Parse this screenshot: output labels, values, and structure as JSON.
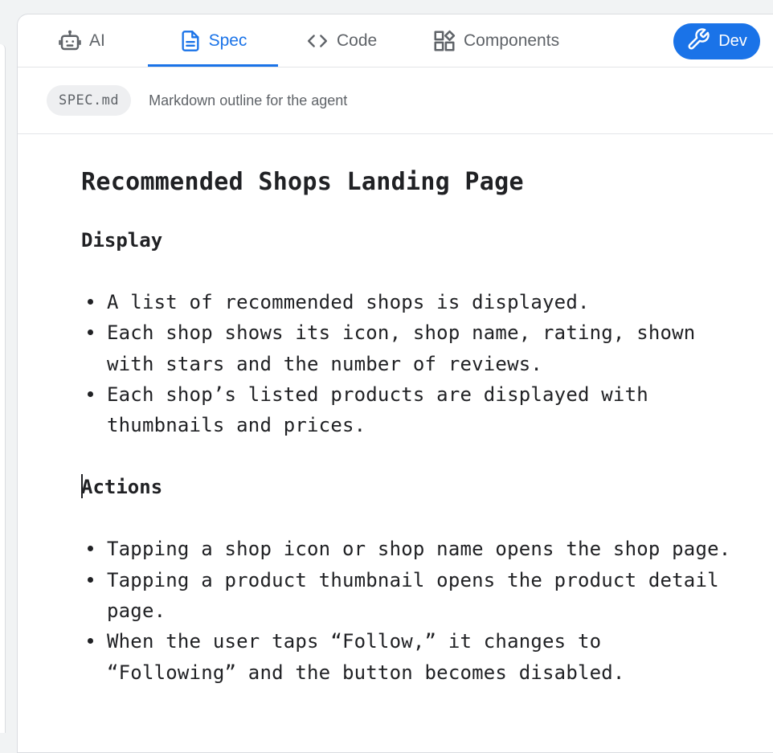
{
  "tabs": [
    {
      "label": "AI",
      "icon": "robot-icon",
      "active": false
    },
    {
      "label": "Spec",
      "icon": "document-icon",
      "active": true
    },
    {
      "label": "Code",
      "icon": "code-brackets-icon",
      "active": false
    },
    {
      "label": "Components",
      "icon": "components-grid-icon",
      "active": false
    }
  ],
  "dev_button": {
    "label": "Dev",
    "icon": "wrench-icon"
  },
  "file": {
    "name": "SPEC.md",
    "description": "Markdown outline for the agent"
  },
  "document": {
    "title": "Recommended Shops Landing Page",
    "sections": [
      {
        "heading": "Display",
        "items": [
          "A list of recommended shops is displayed.",
          "Each shop shows its icon, shop name, rating, shown with stars and the number of reviews.",
          "Each shop’s listed products are displayed with thumbnails and prices."
        ]
      },
      {
        "heading": "Actions",
        "items": [
          "Tapping a shop icon or shop name opens the shop page.",
          "Tapping a product thumbnail opens the product detail page.",
          "When the user taps “Follow,” it changes to “Following” and the button becomes disabled."
        ]
      }
    ]
  },
  "colors": {
    "accent": "#1a73e8",
    "text": "#202124",
    "muted": "#5f6368"
  }
}
